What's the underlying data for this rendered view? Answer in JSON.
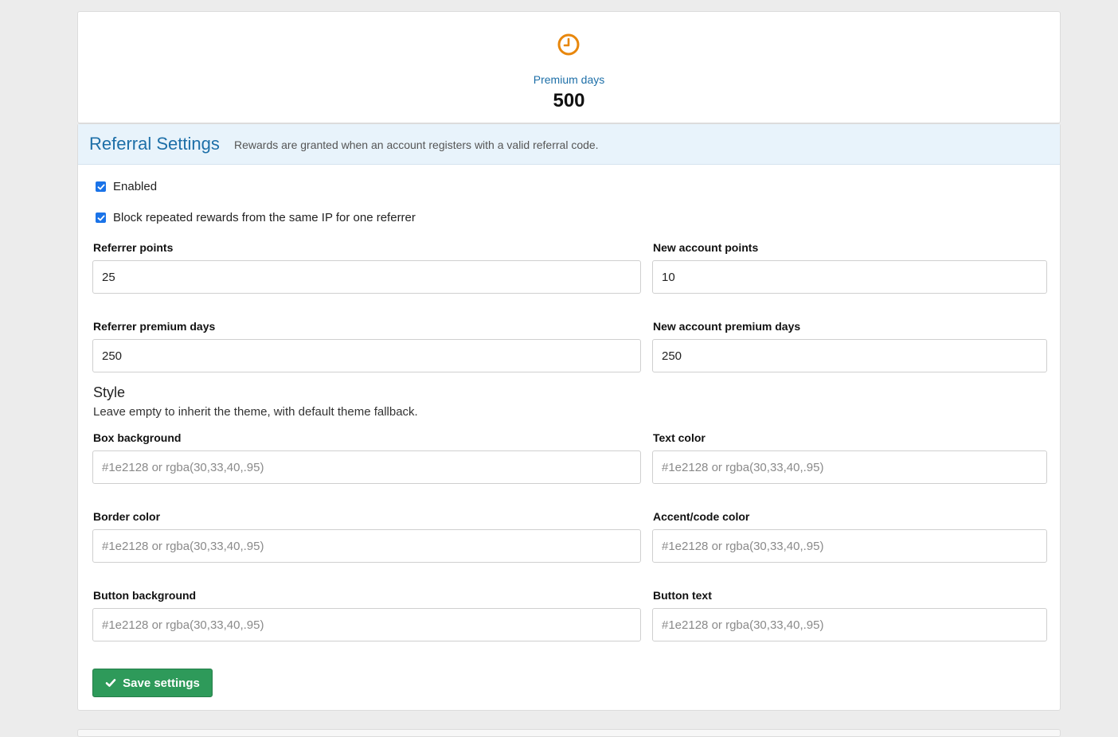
{
  "stat": {
    "icon": "clock-icon",
    "label": "Premium days",
    "value": "500",
    "accent_color": "#e8870c"
  },
  "panel": {
    "title": "Referral Settings",
    "description": "Rewards are granted when an account registers with a valid referral code."
  },
  "options": {
    "enabled_label": "Enabled",
    "enabled_checked": true,
    "block_ip_label": "Block repeated rewards from the same IP for one referrer",
    "block_ip_checked": true
  },
  "fields": {
    "referrer_points": {
      "label": "Referrer points",
      "value": "25"
    },
    "new_account_points": {
      "label": "New account points",
      "value": "10"
    },
    "referrer_premium_days": {
      "label": "Referrer premium days",
      "value": "250"
    },
    "new_account_premium_days": {
      "label": "New account premium days",
      "value": "250"
    }
  },
  "style": {
    "title": "Style",
    "description": "Leave empty to inherit the theme, with default theme fallback.",
    "placeholder": "#1e2128 or rgba(30,33,40,.95)",
    "box_background_label": "Box background",
    "text_color_label": "Text color",
    "border_color_label": "Border color",
    "accent_color_label": "Accent/code color",
    "button_background_label": "Button background",
    "button_text_label": "Button text"
  },
  "actions": {
    "save_label": "Save settings",
    "save_icon": "check-icon",
    "save_color": "#2e9a5a"
  }
}
